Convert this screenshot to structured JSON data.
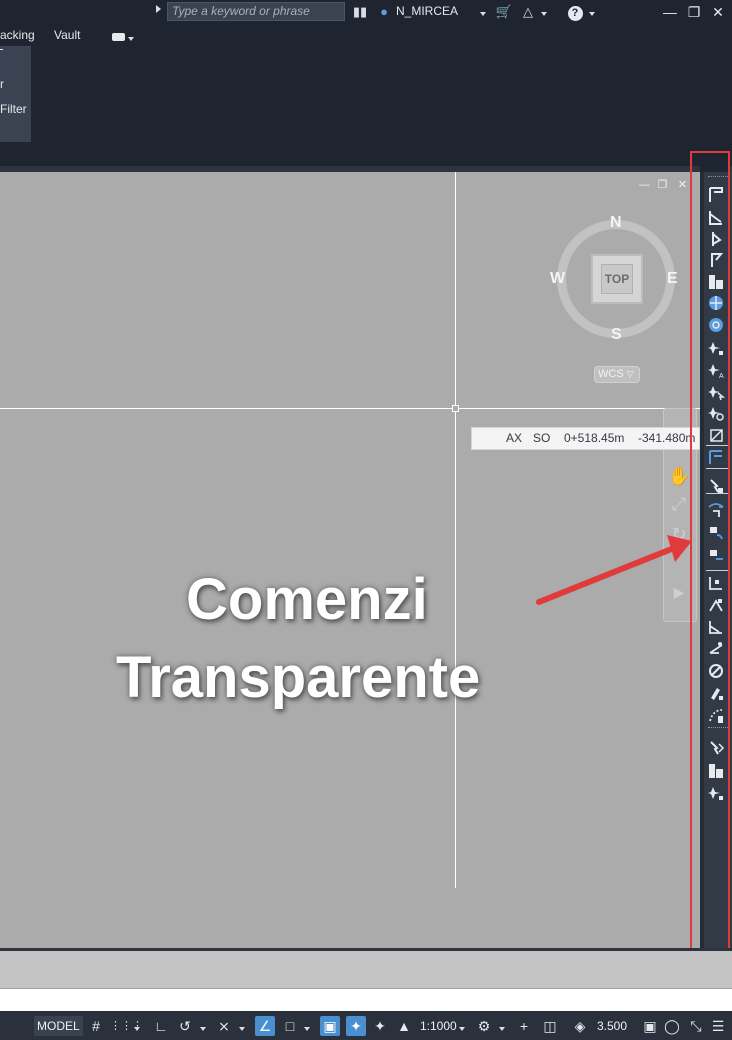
{
  "titlebar": {
    "search_placeholder": "Type a keyword or phrase",
    "user": "N_MIRCEA",
    "icons": [
      "binoculars-icon",
      "user-icon",
      "cart-icon",
      "autodesk-a360-icon",
      "help-icon"
    ],
    "window_controls": [
      "minimize",
      "restore",
      "close"
    ]
  },
  "ribbon": {
    "tabs": [
      "acking",
      "Vault"
    ],
    "panel_items": [
      "r",
      "Filter"
    ]
  },
  "viewport": {
    "controls": [
      "minimize",
      "restore",
      "close"
    ],
    "compass": {
      "north": "N",
      "south": "S",
      "east": "E",
      "west": "W"
    },
    "viewcube_face": "TOP",
    "ucs_label": "WCS",
    "coord_tooltip": {
      "field1": "AX",
      "field2": "SO",
      "station": "0+518.45m",
      "offset": "-341.480m"
    },
    "overlay_line1": "Comenzi",
    "overlay_line2": "Transparente"
  },
  "tool_palette": {
    "icons": [
      "station-offset-icon",
      "profile-station-icon",
      "station-elevation-icon",
      "point-flag-icon",
      "object-list-icon",
      "zone-globe-icon",
      "grid-globe-icon",
      "point-number-icon",
      "point-name-icon",
      "point-object-icon",
      "point-find-icon",
      "side-shot-icon",
      "profile-grade-icon",
      "select-point-icon",
      "angle-distance-icon",
      "deflection-icon",
      "bearing-distance-icon",
      "northing-easting-icon",
      "grid-northing-icon",
      "latitude-icon",
      "azimuth-icon",
      "direction-icon",
      "object-pick-icon",
      "distance-tool-icon",
      "filter-object-icon",
      "table-icon",
      "point-star-icon"
    ]
  },
  "statusbar": {
    "model_label": "MODEL",
    "scale": "1:1000",
    "lineweight": "3.500"
  },
  "colors": {
    "background": "#1f2530",
    "drawing_area": "#ababab",
    "palette": "#323a46",
    "highlight_frame": "#e03b3b",
    "status_active": "#4a8fd0"
  }
}
